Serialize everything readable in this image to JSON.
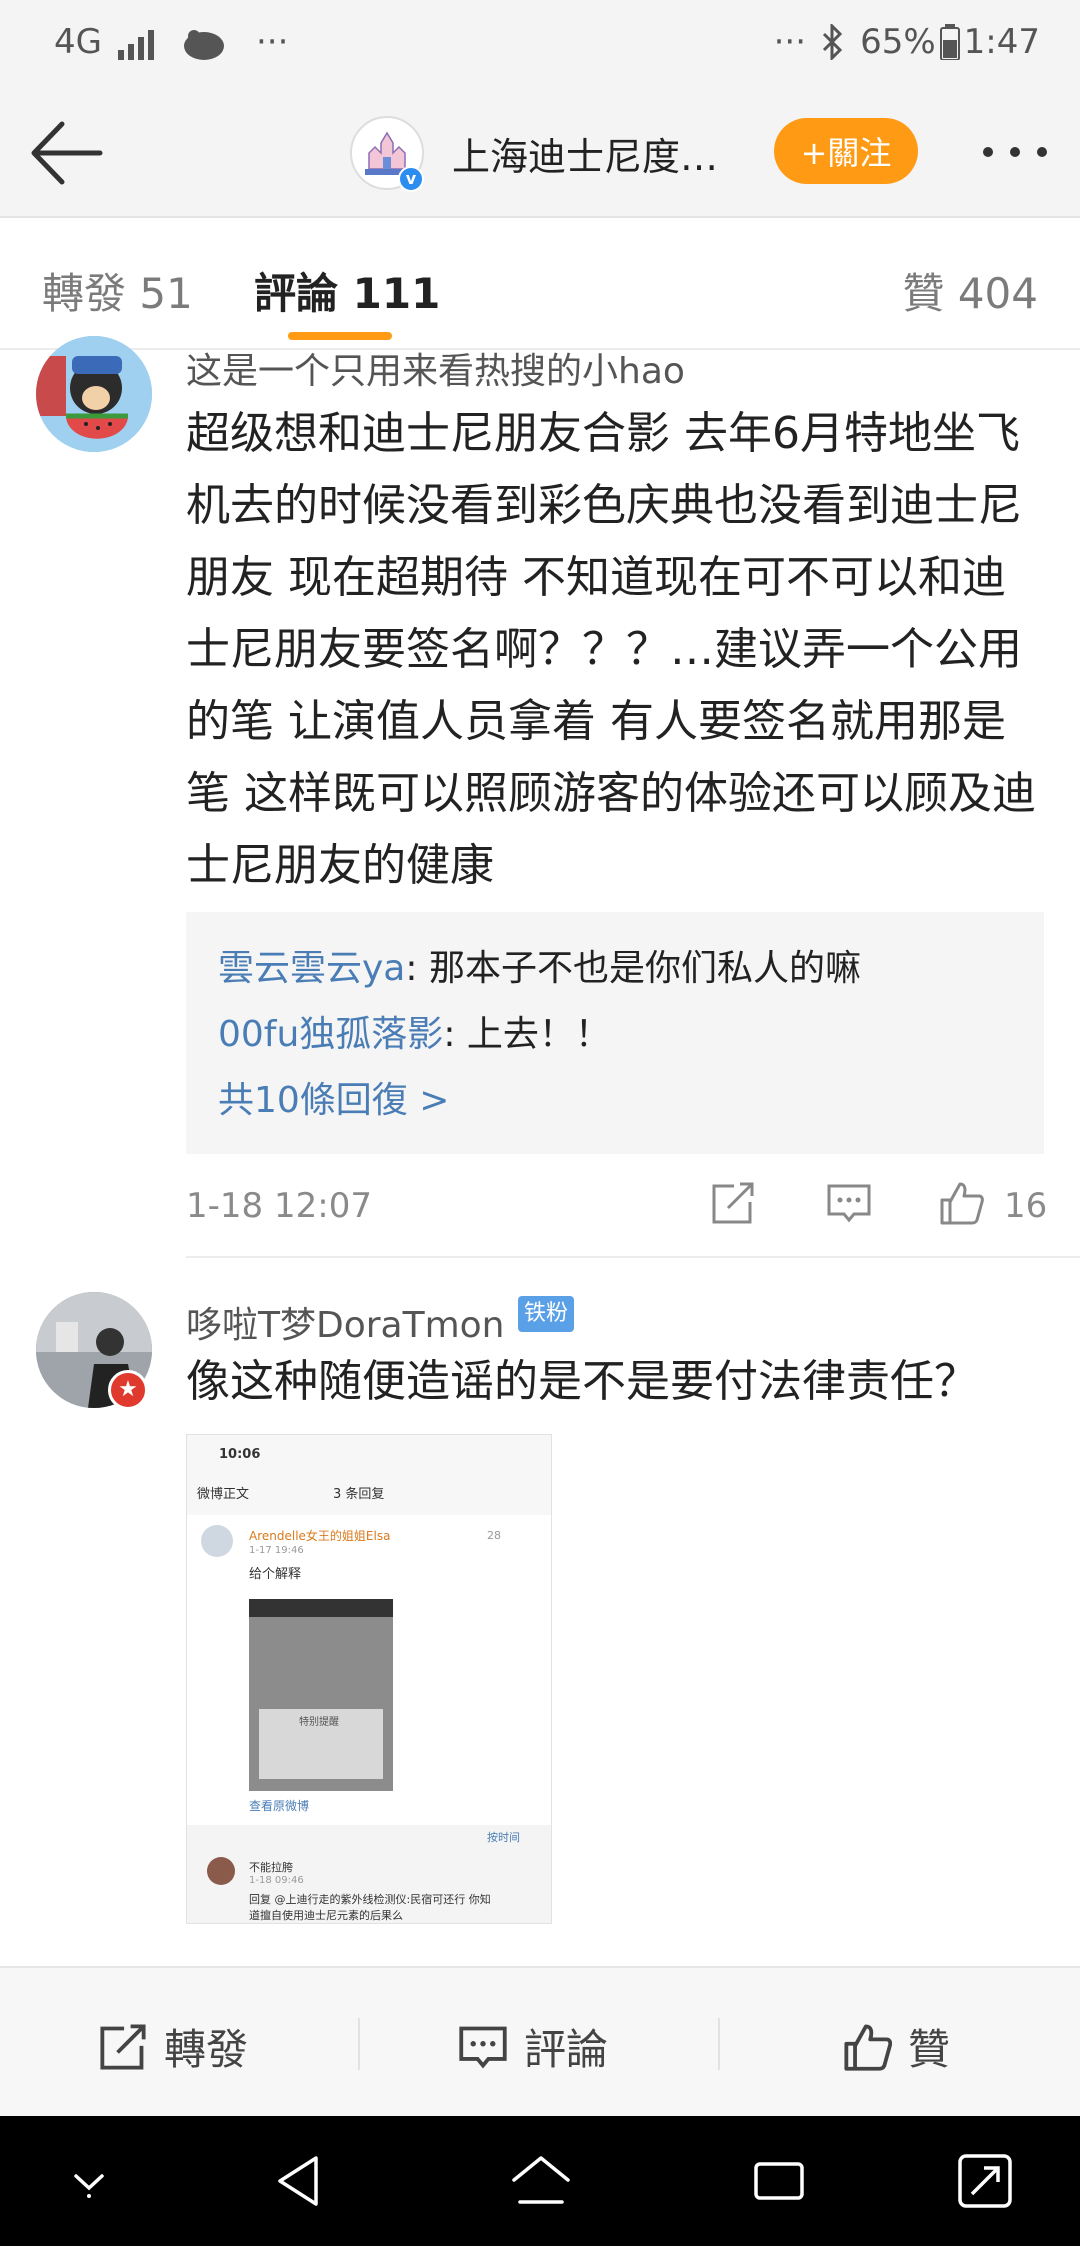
{
  "status_bar": {
    "network": "4G",
    "left_more": "···",
    "right_more": "···",
    "battery": "65%",
    "time": "1:47"
  },
  "header": {
    "title": "上海迪士尼度…",
    "follow_label": "+關注"
  },
  "tabs": [
    {
      "label": "轉發 51"
    },
    {
      "label": "評論 111"
    },
    {
      "label": "贊 404"
    }
  ],
  "comments": [
    {
      "username": "这是一个只用来看热搜的小hao",
      "text": "超级想和迪士尼朋友合影 去年6月特地坐飞机去的时候没看到彩色庆典也没看到迪士尼朋友 现在超期待 不知道现在可不可以和迪士尼朋友要签名啊？？？…建议弄一个公用的笔 让演值人员拿着 有人要签名就用那是笔 这样既可以照顾游客的体验还可以顾及迪士尼朋友的健康",
      "replies": [
        {
          "user": "雲云雲云ya",
          "text": ": 那本子不也是你们私人的嘛"
        },
        {
          "user": "00fu独孤落影",
          "text": ": 上去！！"
        }
      ],
      "more_replies": "共10條回復 >",
      "time": "1-18 12:07",
      "likes": "16"
    },
    {
      "username": "哆啦T梦DoraTmon",
      "badge": "铁粉",
      "text": "像这种随便造谣的是不是要付法律责任？",
      "screenshot": {
        "time": "10:06",
        "back": "微博正文",
        "heading": "3 条回复",
        "reply_user": "Arendelle女王的姐姐Elsa",
        "reply_time": "1-17 19:46",
        "reply_likes": "28",
        "reply_text": "给个解释",
        "view_original": "查看原微博",
        "sort_label": "按时间",
        "sub_user": "不能拉胯",
        "sub_time": "1-18 09:46",
        "sub_text_1": "回复 @上迪行走的紫外线检测仪:民宿可还行 你知",
        "sub_text_2": "道擅自使用迪士尼元素的后果么",
        "inner_notice": "特别提醒"
      }
    }
  ],
  "action_bar": {
    "repost": "轉發",
    "comment": "評論",
    "like": "贊"
  },
  "colors": {
    "accent": "#ff9a14",
    "link": "#4a7db5",
    "badge": "#5aa0e6"
  }
}
